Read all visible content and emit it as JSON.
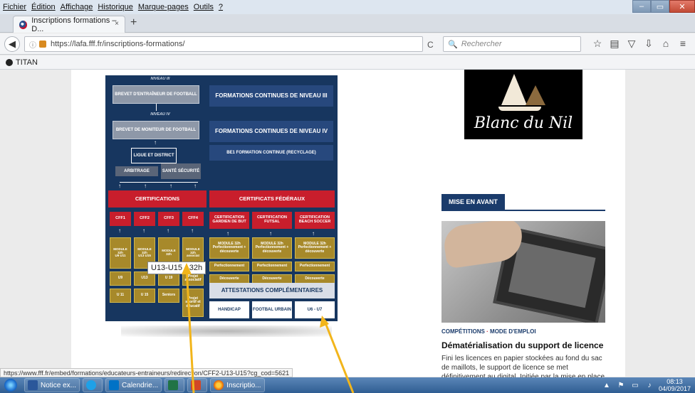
{
  "menubar": [
    "Fichier",
    "Édition",
    "Affichage",
    "Historique",
    "Marque-pages",
    "Outils",
    "?"
  ],
  "window_controls": {
    "min": "–",
    "max": "▭",
    "close": "✕"
  },
  "tab": {
    "title": "Inscriptions formations – D...",
    "close": "×",
    "new": "+"
  },
  "nav": {
    "url": "https://lafa.fff.fr/inscriptions-formations/",
    "search_placeholder": "Rechercher",
    "reload": "C"
  },
  "bookmarks": {
    "item": "TITAN"
  },
  "diagram": {
    "niveau_iii": "NIVEAU III",
    "brevet_entraineur": "BREVET D'ENTRAÎNEUR DE FOOTBALL",
    "niveau_iv": "NIVEAU IV",
    "brevet_moniteur": "BREVET DE MONITEUR DE FOOTBALL",
    "ligue": "LIGUE ET DISTRICT",
    "arbitrage": "ARBITRAGE",
    "sante": "SANTÉ SÉCURITÉ",
    "fc3": "FORMATIONS CONTINUES DE NIVEAU III",
    "fc4": "FORMATIONS CONTINUES DE NIVEAU IV",
    "be1": "BE1 FORMATION CONTINUE (RECYCLAGE)",
    "certifications": "CERTIFICATIONS",
    "certificats": "CERTIFICATS FÉDÉRAUX",
    "cff": [
      "CFF1",
      "CFF2",
      "CFF3",
      "CFF4"
    ],
    "cert_gardien": "CERTIFICATION GARDIEN DE BUT",
    "cert_futsal": "CERTIFICATION FUTSAL",
    "cert_beach": "CERTIFICATION BEACH SOCCER",
    "module": "MODULE 32h",
    "module_pd": "MODULE 32h Perfectionnement + découverte",
    "modules_u": [
      "U9 U11",
      "U13 U15",
      "",
      "associat"
    ],
    "perfectionnement": "Perfectionnement",
    "decouverte": "Découverte",
    "row3": [
      "U9",
      "U13",
      "U 19",
      "Projet associatif"
    ],
    "row4": [
      "U 11",
      "U 15",
      "Seniors",
      "Projet sportif et éducatif"
    ],
    "attestations": "ATTESTATIONS COMPLÉMENTAIRES",
    "att": [
      "HANDICAP",
      "FOOTBAL URBAIN",
      "U6 - U7"
    ],
    "tooltip": "U13-U15 - 32h"
  },
  "ad": {
    "logo": "Blanc du Nil"
  },
  "mise_en_avant": {
    "label": "MISE EN AVANT",
    "category": "COMPÉTITIONS",
    "category_sep": "·",
    "category2": "MODE D'EMPLOI",
    "headline": "Dématérialisation du support de licence",
    "excerpt": "Fini les licences en papier stockées au fond du sac de maillots, le support de licence se met définitivement au digital. Initiée par la mise en place de la Feuille de"
  },
  "status_url": "https://www.fff.fr/embed/formations/educateurs-entraineurs/redirection/CFF2-U13-U15?cg_cod=5621",
  "taskbar": {
    "items": [
      "Notice ex...",
      "",
      "Calendrie...",
      "",
      "",
      "Inscriptio..."
    ],
    "time": "08:13",
    "date": "04/09/2017"
  }
}
